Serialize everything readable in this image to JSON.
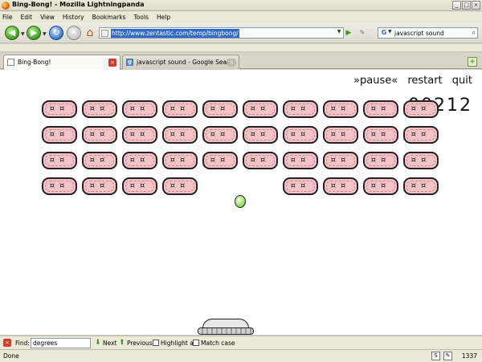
{
  "window": {
    "title": "Bing-Bong! - Mozilla Lightningpanda",
    "controls": [
      "_",
      "□",
      "×"
    ]
  },
  "menu": [
    "File",
    "Edit",
    "View",
    "History",
    "Bookmarks",
    "Tools",
    "Help"
  ],
  "nav": {
    "back_icon": "back-arrow-icon",
    "forward_icon": "forward-arrow-icon",
    "url": "http://www.zentastic.com/temp/bingbong/",
    "search_engine": "G",
    "search_value": "javascript sound"
  },
  "tabs": [
    {
      "label": "Bing-Bong!",
      "active": true
    },
    {
      "label": "javascript sound - Google Search",
      "active": false
    }
  ],
  "game": {
    "controls": [
      "»pause«",
      "restart",
      "quit"
    ],
    "score": "00212",
    "bricks": [
      [
        1,
        1,
        1,
        1,
        1,
        1,
        1,
        1,
        1,
        1
      ],
      [
        1,
        1,
        1,
        1,
        1,
        1,
        1,
        1,
        1,
        1
      ],
      [
        1,
        1,
        1,
        1,
        1,
        1,
        1,
        1,
        1,
        1
      ],
      [
        1,
        1,
        1,
        1,
        0,
        0,
        1,
        1,
        1,
        1
      ]
    ],
    "brick_face": "¤¤",
    "colors": {
      "brick": "#f3c3c8",
      "ball": "#9ae06a",
      "outline": "#222222"
    }
  },
  "findbar": {
    "label": "Find:",
    "value": "degrees",
    "next": "Next",
    "previous": "Previous",
    "highlight": "Highlight all",
    "match_case": "Match case"
  },
  "status": {
    "text": "Done",
    "count": "1337"
  }
}
